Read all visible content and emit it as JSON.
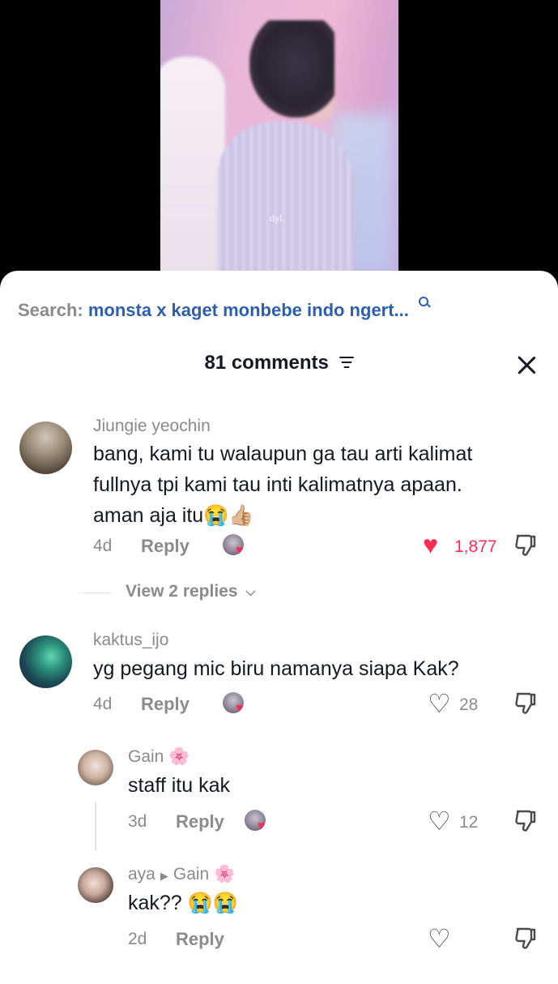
{
  "video": {
    "watermark": "dyl."
  },
  "search": {
    "label": "Search:",
    "query": "monsta x kaget monbebe indo ngert..."
  },
  "comments_header": {
    "title": "81 comments"
  },
  "comments": [
    {
      "username": "Jiungie yeochin",
      "text_lines": [
        "bang, kami tu walaupun ga tau arti kalimat",
        "fullnya tpi kami tau inti kalimatnya apaan.",
        "aman aja itu😭👍🏼"
      ],
      "age": "4d",
      "reply_label": "Reply",
      "likes": "1,877",
      "liked": true,
      "view_replies": "View 2 replies"
    },
    {
      "username": "kaktus_ijo",
      "text_lines": [
        "yg pegang mic biru namanya siapa Kak?"
      ],
      "age": "4d",
      "reply_label": "Reply",
      "likes": "28",
      "liked": false
    }
  ],
  "replies": [
    {
      "username": "Gain 🌸",
      "text": "staff itu kak",
      "age": "3d",
      "reply_label": "Reply",
      "likes": "12"
    },
    {
      "username": "aya",
      "reply_to": "Gain 🌸",
      "text": "kak?? 😭😭",
      "age": "2d",
      "reply_label": "Reply",
      "likes": ""
    }
  ],
  "colors": {
    "search_query": "#2d5fad",
    "like_red": "#fe2c55",
    "text_primary": "#161823",
    "text_secondary": "#8a8a8f"
  }
}
